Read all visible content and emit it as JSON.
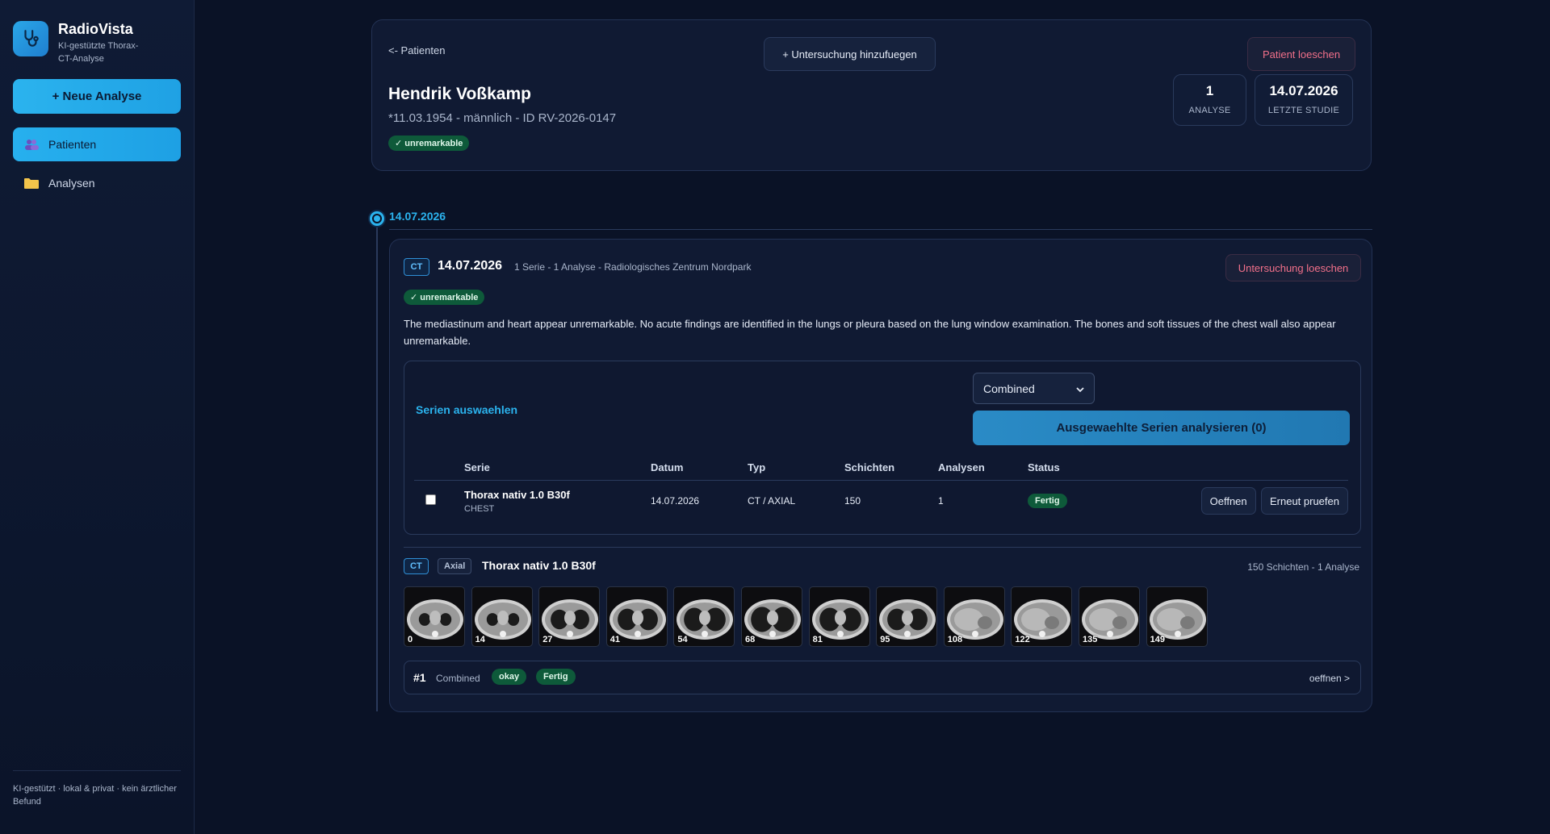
{
  "brand": {
    "name": "RadioVista",
    "subtitle": "KI-gestützte Thorax-CT-Analyse",
    "logo_icon": "stethoscope-icon"
  },
  "sidebar": {
    "new_analysis_label": "+ Neue Analyse",
    "items": [
      {
        "label": "Patienten",
        "icon": "users-icon",
        "active": true
      },
      {
        "label": "Analysen",
        "icon": "folder-icon",
        "active": false
      }
    ],
    "footer": "KI-gestützt · lokal & privat · kein ärztlicher Befund"
  },
  "patient": {
    "back_label": "<- Patienten",
    "add_exam_label": "+ Untersuchung hinzufuegen",
    "delete_label": "Patient loeschen",
    "name": "Hendrik Voßkamp",
    "meta": "*11.03.1954 - männlich - ID RV-2026-0147",
    "badge": "✓ unremarkable",
    "stats": [
      {
        "value": "1",
        "label": "ANALYSE"
      },
      {
        "value": "14.07.2026",
        "label": "LETZTE STUDIE"
      }
    ]
  },
  "timeline": {
    "date": "14.07.2026"
  },
  "exam": {
    "modality": "CT",
    "date": "14.07.2026",
    "meta": "1 Serie - 1 Analyse - Radiologisches Zentrum Nordpark",
    "delete_label": "Untersuchung loeschen",
    "badge": "✓ unremarkable",
    "report": "The mediastinum and heart appear unremarkable. No acute findings are identified in the lungs or pleura based on the lung window examination. The bones and soft tissues of the chest wall also appear unremarkable.",
    "series_select": {
      "title": "Serien auswaehlen",
      "mode_value": "Combined",
      "mode_options": [
        "Combined"
      ],
      "analyze_label": "Ausgewaehlte Serien analysieren (0)",
      "headers": [
        "Serie",
        "Datum",
        "Typ",
        "Schichten",
        "Analysen",
        "Status"
      ],
      "rows": [
        {
          "name": "Thorax nativ 1.0 B30f",
          "body_part": "CHEST",
          "date": "14.07.2026",
          "type": "CT / AXIAL",
          "slices": "150",
          "analyses": "1",
          "status": "Fertig",
          "open_label": "Oeffnen",
          "recheck_label": "Erneut pruefen"
        }
      ]
    },
    "series_detail": {
      "modality": "CT",
      "orientation": "Axial",
      "name": "Thorax nativ 1.0 B30f",
      "summary": "150 Schichten - 1 Analyse",
      "thumbnails": [
        "0",
        "14",
        "27",
        "41",
        "54",
        "68",
        "81",
        "95",
        "108",
        "122",
        "135",
        "149"
      ]
    },
    "analysis": {
      "index": "#1",
      "mode": "Combined",
      "result_badge": "okay",
      "status_badge": "Fertig",
      "open_label": "oeffnen >"
    }
  },
  "colors": {
    "accent": "#27b0ee",
    "background": "#0a1226",
    "success": "#0e5a3a",
    "danger": "#f2708a"
  }
}
